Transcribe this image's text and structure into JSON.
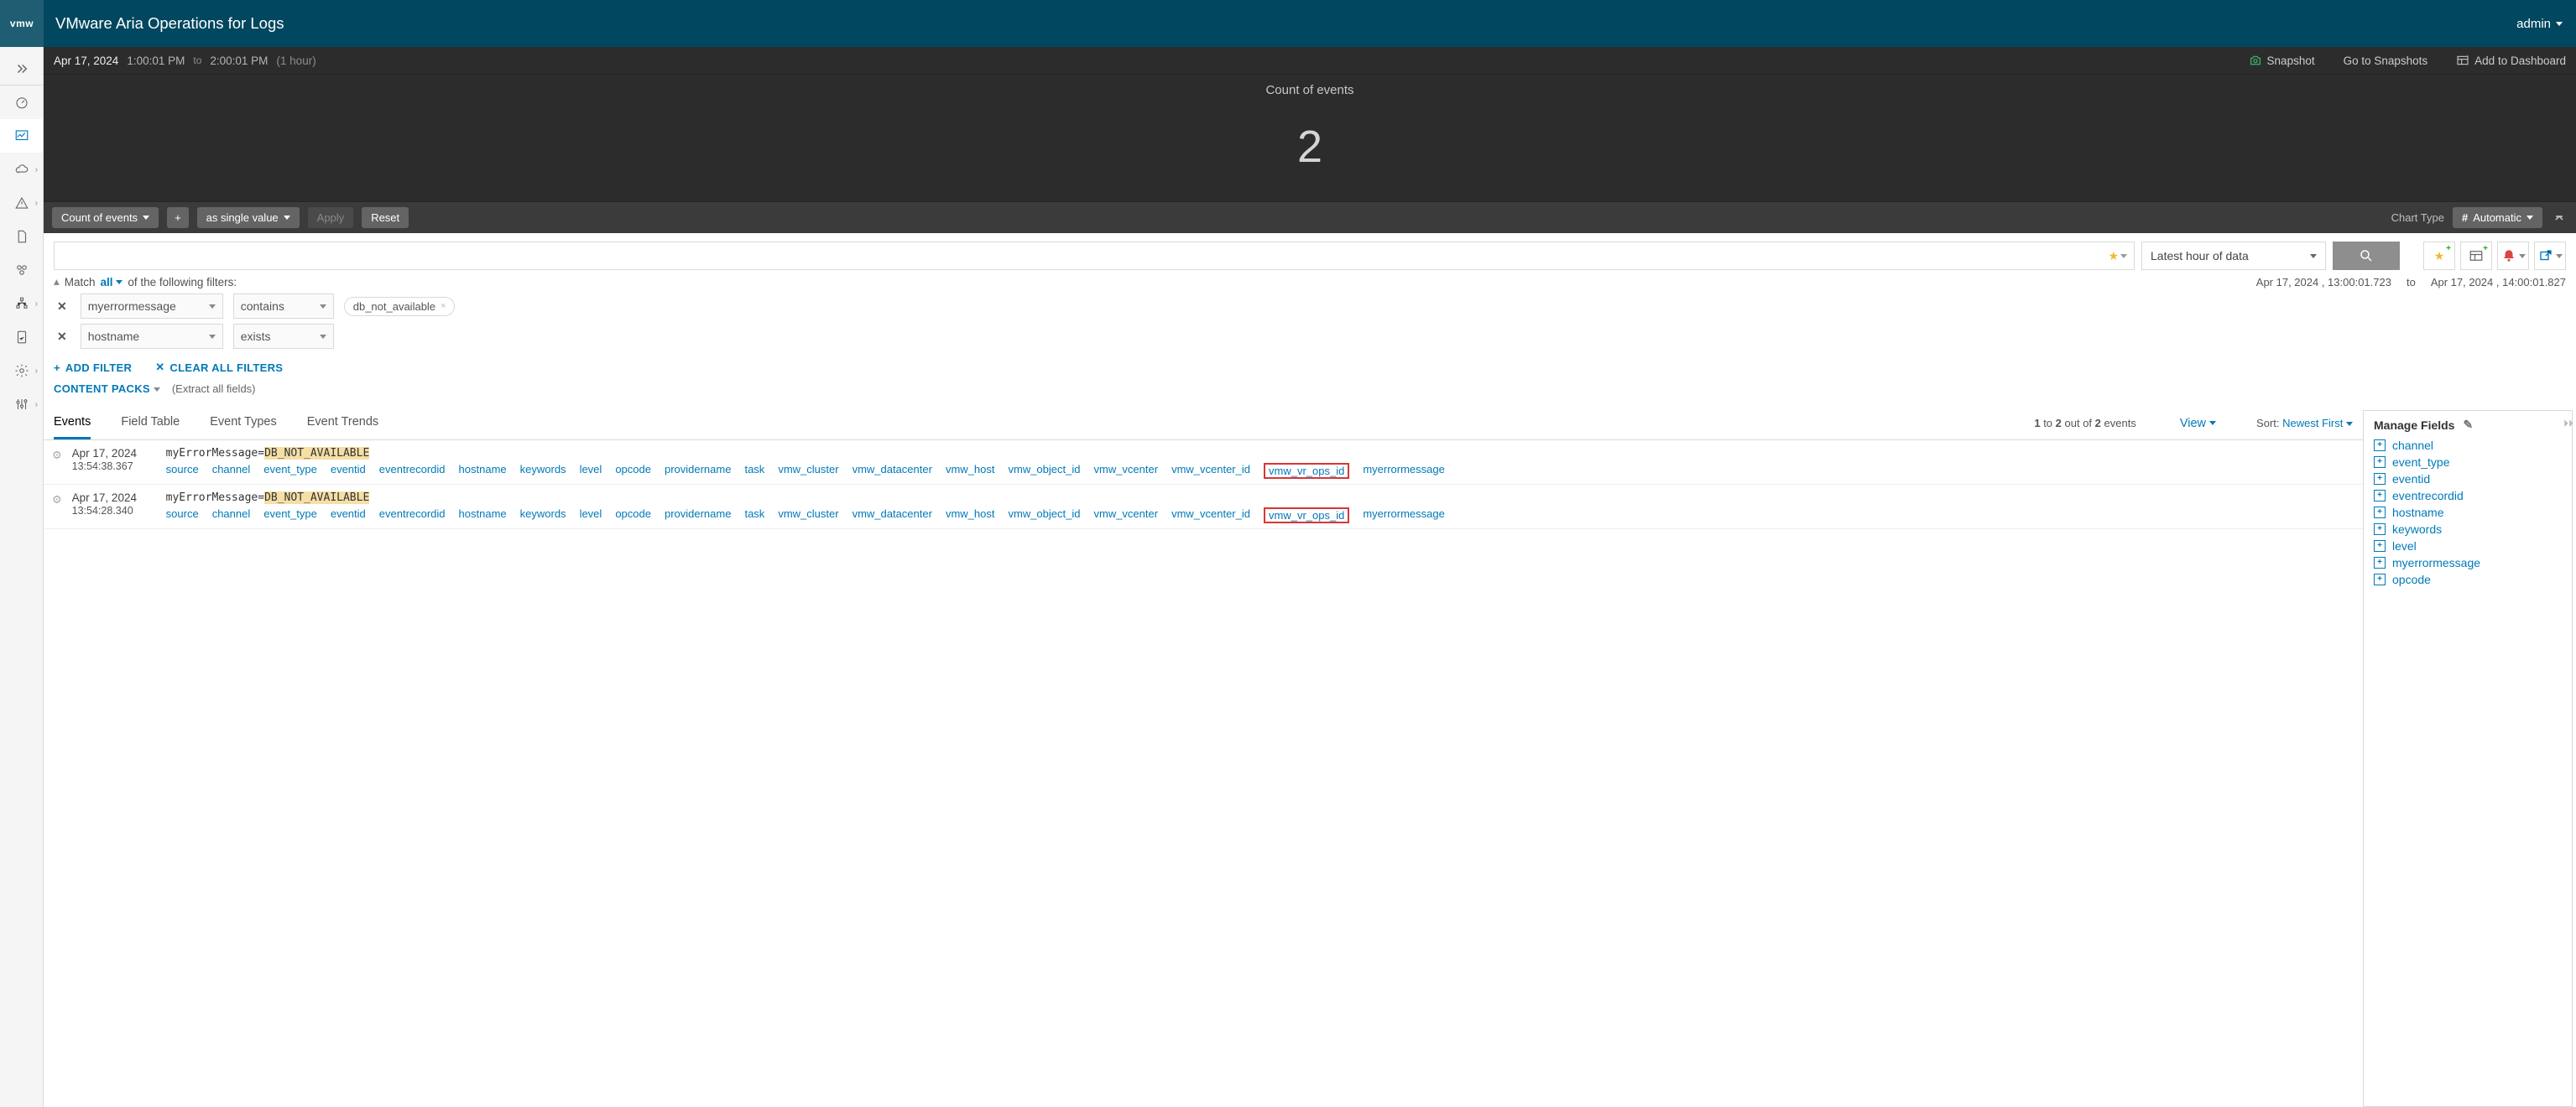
{
  "app_title": "VMware Aria Operations for Logs",
  "logo_text": "vmw",
  "user": "admin",
  "timebar": {
    "date": "Apr 17, 2024",
    "from": "1:00:01 PM",
    "to_label": "to",
    "to": "2:00:01 PM",
    "duration": "(1 hour)",
    "snapshot": "Snapshot",
    "goto_snapshots": "Go to Snapshots",
    "add_dashboard": "Add to Dashboard"
  },
  "chart_data": {
    "type": "table",
    "title": "Count of events",
    "value": "2"
  },
  "chart_tools": {
    "count": "Count of events",
    "add": "+",
    "as_single": "as single value",
    "apply": "Apply",
    "reset": "Reset",
    "chart_type_label": "Chart Type",
    "automatic": "Automatic"
  },
  "search": {
    "placeholder": "",
    "timerange": "Latest hour of data"
  },
  "match": {
    "prefix": "Match",
    "all": "all",
    "suffix": "of the following filters:",
    "ts_from": "Apr 17, 2024 ,  13:00:01.723",
    "ts_to_label": "to",
    "ts_to": "Apr 17, 2024 ,  14:00:01.827"
  },
  "filters": [
    {
      "field": "myerrormessage",
      "op": "contains",
      "value": "db_not_available"
    },
    {
      "field": "hostname",
      "op": "exists",
      "value": null
    }
  ],
  "filter_actions": {
    "add": "ADD FILTER",
    "clear": "CLEAR ALL FILTERS"
  },
  "content_packs": {
    "label": "CONTENT PACKS",
    "extract": "(Extract all fields)"
  },
  "tabs": {
    "items": [
      "Events",
      "Field Table",
      "Event Types",
      "Event Trends"
    ],
    "active": 0,
    "count_text_a": "1",
    "count_text_b": "to",
    "count_text_c": "2",
    "count_text_d": "out of",
    "count_text_e": "2",
    "count_text_f": "events",
    "view": "View",
    "sort_label": "Sort:",
    "sort_value": "Newest First"
  },
  "events": [
    {
      "date": "Apr 17, 2024",
      "time": "13:54:38.367",
      "msg_prefix": "myErrorMessage=",
      "msg_hl": "DB_NOT_AVAILABLE"
    },
    {
      "date": "Apr 17, 2024",
      "time": "13:54:28.340",
      "msg_prefix": "myErrorMessage=",
      "msg_hl": "DB_NOT_AVAILABLE"
    }
  ],
  "event_tags": [
    "source",
    "channel",
    "event_type",
    "eventid",
    "eventrecordid",
    "hostname",
    "keywords",
    "level",
    "opcode",
    "providername",
    "task",
    "vmw_cluster",
    "vmw_datacenter",
    "vmw_host",
    "vmw_object_id",
    "vmw_vcenter",
    "vmw_vcenter_id",
    "vmw_vr_ops_id",
    "myerrormessage"
  ],
  "boxed_tag": "vmw_vr_ops_id",
  "manage_fields": {
    "title": "Manage Fields",
    "fields": [
      "channel",
      "event_type",
      "eventid",
      "eventrecordid",
      "hostname",
      "keywords",
      "level",
      "myerrormessage",
      "opcode"
    ]
  }
}
